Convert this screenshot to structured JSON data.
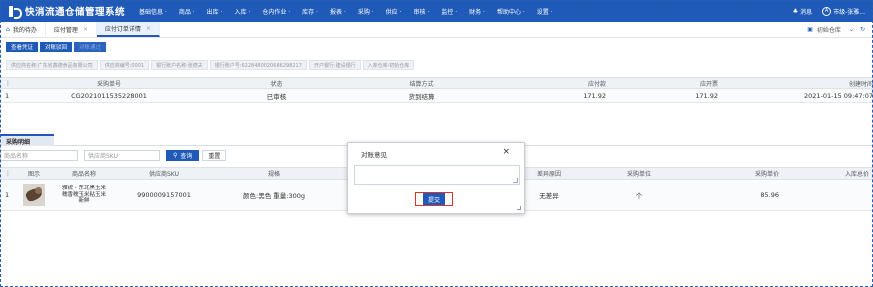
{
  "app": {
    "title": "快消流通仓储管理系统",
    "menu": [
      "基础信息 ·",
      "商品 ·",
      "出库 ·",
      "入库 ·",
      "仓内作业 ·",
      "库存 ·",
      "报表 ·",
      "采购 ·",
      "供应 ·",
      "审核 ·",
      "监控 ·",
      "财务 ·",
      "帮助中心 ·",
      "设置 ·"
    ],
    "message_label": "消息",
    "user_label": "市级-张雅..."
  },
  "tabs": {
    "home": "我的待办",
    "items": [
      {
        "label": "应付管理",
        "active": false
      },
      {
        "label": "应付订单详情",
        "active": true
      }
    ],
    "close_glyph": "×",
    "warehouse_label": "初始仓库",
    "warehouse_caret": "⌄"
  },
  "actions": [
    "查看凭证",
    "对账驳回",
    "对账通过"
  ],
  "info_chips": [
    "供应商名称:广东省鑫德食品有限公司",
    "供应商编号:0001",
    "银行账户名称:张德夫",
    "银行账户号:6228480020686298217",
    "开户银行:建设银行",
    "入库仓库:初始仓库"
  ],
  "order_table": {
    "headers": [
      "",
      "采购单号",
      "状态",
      "结算方式",
      "应付款",
      "应开票",
      "创建时间"
    ],
    "rows": [
      [
        "1",
        "CG2021011535228001",
        "已审核",
        "货到结算",
        "171.92",
        "171.92",
        "2021-01-15 09:47:07"
      ]
    ]
  },
  "detail": {
    "tab_label": "采购明细",
    "name_placeholder": "商品名称",
    "sku_placeholder": "供应商SKU",
    "query_label": "查询",
    "reset_label": "重置",
    "headers": [
      "",
      "图示",
      "商品名称",
      "供应商SKU",
      "规格",
      "",
      "差异原因",
      "采购单位",
      "采购单价",
      "入库总价"
    ],
    "rows": [
      {
        "index": "1",
        "name": "雅锐 - 东北黑玉米糯香糯玉米粘玉米新鲜",
        "sku": "9900009157001",
        "spec": "颜色:黑色 重量:300g",
        "reason": "无差异",
        "unit": "个",
        "price": "85.96",
        "total": ""
      }
    ]
  },
  "modal": {
    "title": "对账意见",
    "close_glyph": "×",
    "submit_label": "提交",
    "highlight_color": "#e0322d"
  },
  "colors": {
    "brand": "#1f5ab8"
  }
}
